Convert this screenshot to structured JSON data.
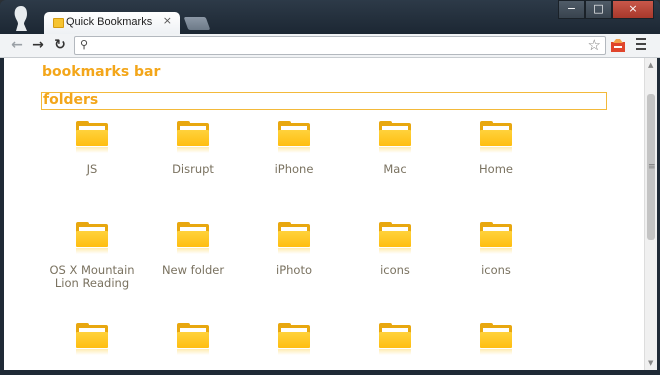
{
  "window": {
    "tab_title": "Quick Bookmarks",
    "close_glyph": "×",
    "buttons": {
      "minimize": "−",
      "maximize": "□",
      "close": "×"
    }
  },
  "toolbar": {
    "back_glyph": "←",
    "forward_glyph": "→",
    "reload_glyph": "↻",
    "search_glyph": "⚲",
    "star_glyph": "☆"
  },
  "page": {
    "section_title": "bookmarks bar",
    "folder_header": "folders",
    "items": [
      {
        "label": "JS"
      },
      {
        "label": "Disrupt"
      },
      {
        "label": "iPhone"
      },
      {
        "label": "Mac"
      },
      {
        "label": "Home"
      },
      {
        "label": "OS X Mountain Lion Reading"
      },
      {
        "label": "New folder"
      },
      {
        "label": "iPhoto"
      },
      {
        "label": "icons"
      },
      {
        "label": "icons"
      },
      {
        "label": ""
      },
      {
        "label": ""
      },
      {
        "label": ""
      },
      {
        "label": ""
      },
      {
        "label": ""
      }
    ]
  },
  "colors": {
    "accent": "#f3a61a",
    "folder": "#ffc21a",
    "label": "#7a7260"
  }
}
